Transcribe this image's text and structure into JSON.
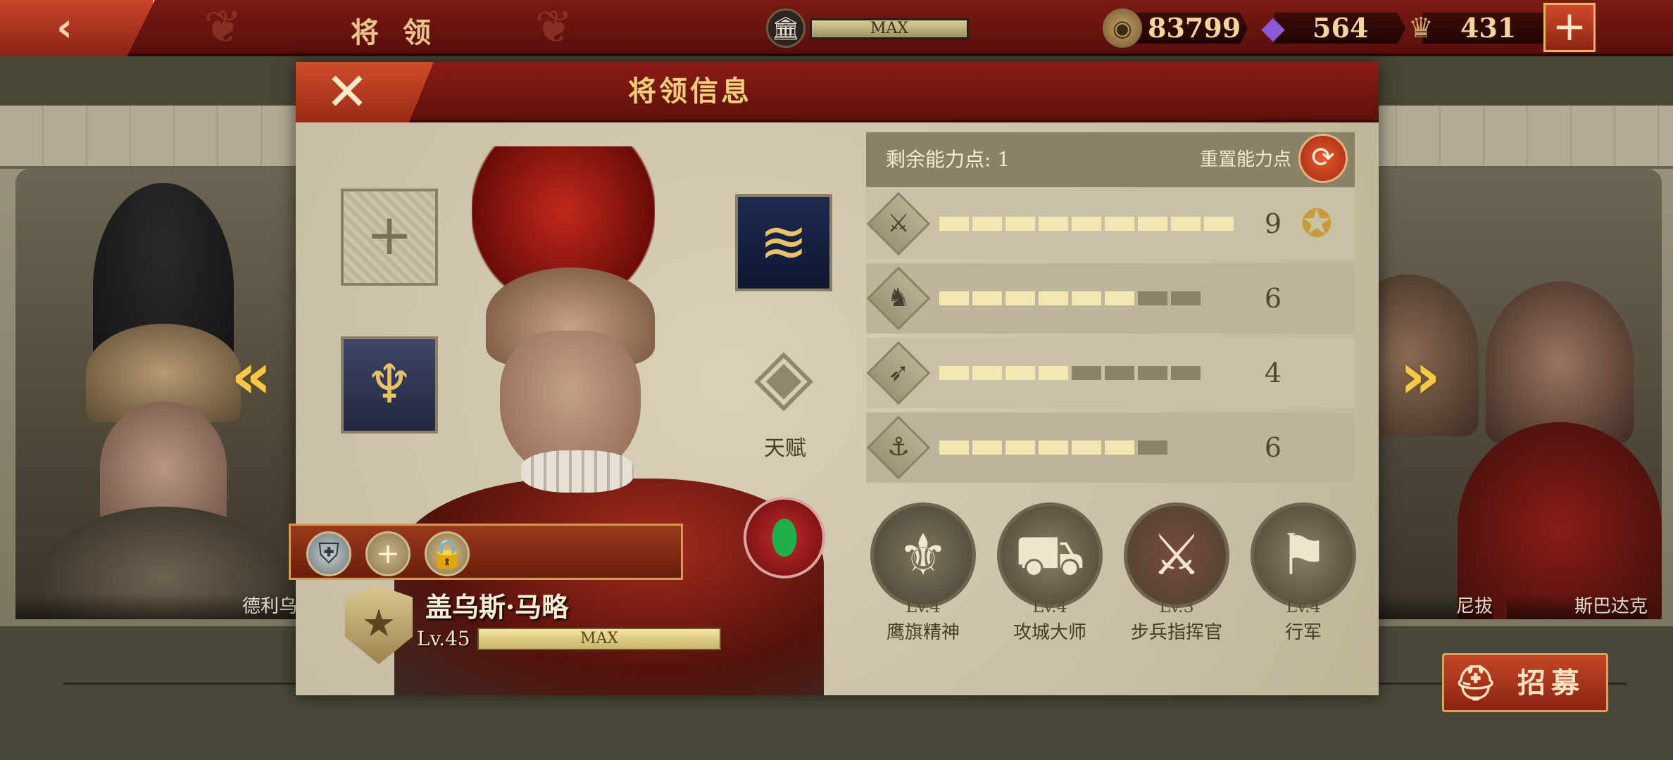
{
  "top_bar": {
    "title": "将 领",
    "building_level": "MAX",
    "resources": [
      {
        "name": "coin",
        "icon": "coin-icon",
        "value": "83799"
      },
      {
        "name": "gem",
        "icon": "gem-icon",
        "value": "564"
      },
      {
        "name": "honor",
        "icon": "eagle-icon",
        "value": "431"
      }
    ]
  },
  "dialog": {
    "title": "将领信息",
    "talent_label": "天赋",
    "hero": {
      "name": "盖乌斯·马略",
      "level": "Lv.45",
      "level_bar": "MAX"
    },
    "ability_points_label": "剩余能力点: 1",
    "reset_label": "重置能力点",
    "stats": [
      {
        "icon": "sword-icon",
        "value": "9",
        "filled": 9,
        "total": 9
      },
      {
        "icon": "horse-icon",
        "value": "6",
        "filled": 6,
        "total": 8
      },
      {
        "icon": "bow-icon",
        "value": "4",
        "filled": 4,
        "total": 8
      },
      {
        "icon": "anchor-icon",
        "value": "6",
        "filled": 6,
        "total": 7
      }
    ],
    "skills": [
      {
        "level": "Lv.4",
        "name": "鹰旗精神",
        "icon": "eagle-banner-icon",
        "color": "#7d7460"
      },
      {
        "level": "Lv.4",
        "name": "攻城大师",
        "icon": "catapult-icon",
        "color": "#8a7f66"
      },
      {
        "level": "Lv.3",
        "name": "步兵指挥官",
        "icon": "crossed-swords-icon",
        "color": "#7a4a40"
      },
      {
        "level": "Lv.4",
        "name": "行军",
        "icon": "marching-soldiers-icon",
        "color": "#8a8068"
      }
    ]
  },
  "side_cards": {
    "left_label": "德利乌",
    "right_labels": [
      "尼拔",
      "斯巴达克"
    ]
  },
  "recruit_label": "招募",
  "colors": {
    "header_red": "#7a1a14",
    "accent_gold": "#e8c58a",
    "bar_fill": "#f2e7b0",
    "bar_empty": "#8b8367"
  }
}
